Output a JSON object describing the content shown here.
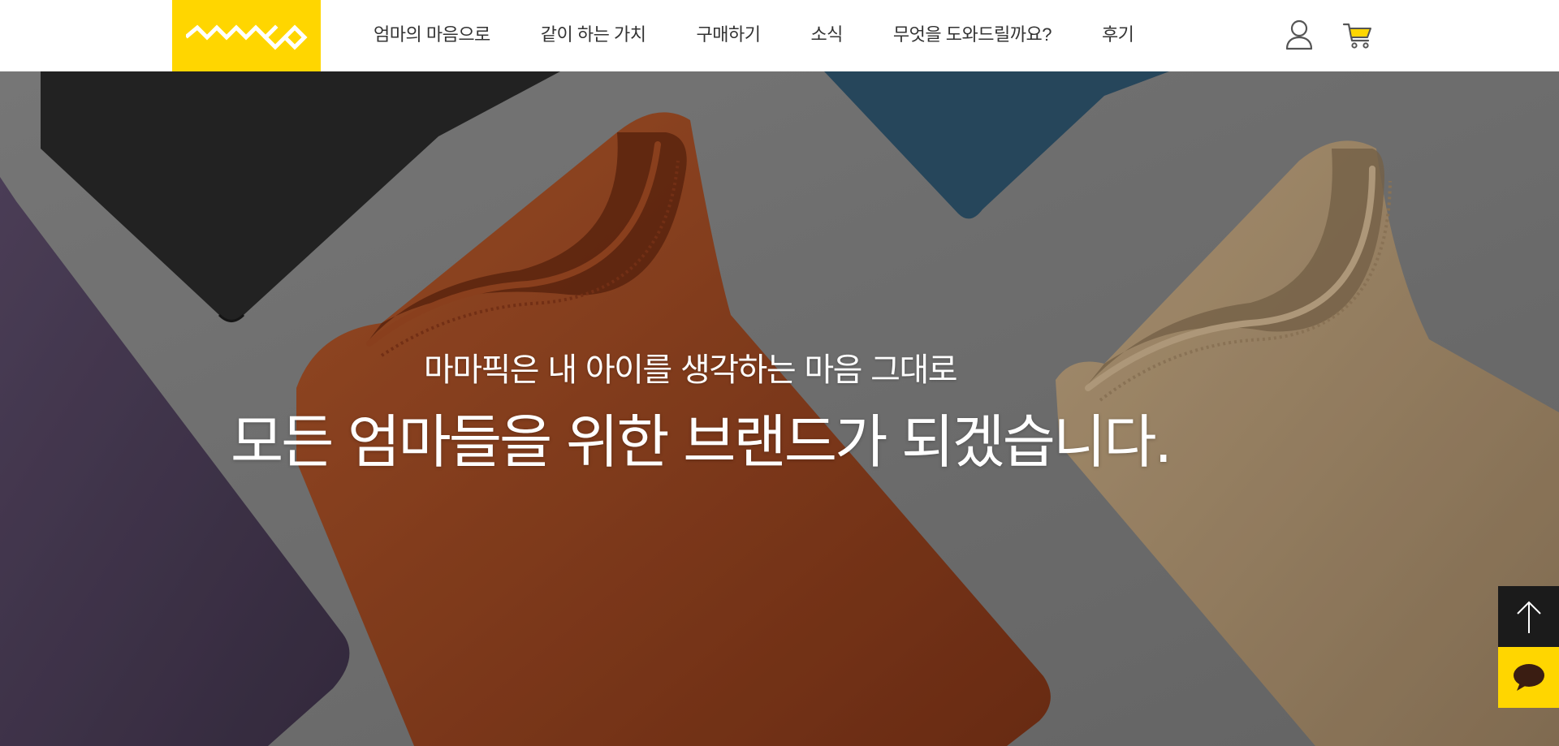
{
  "brand": {
    "logo_icon": "zigzag-logo-icon",
    "accent_color": "#ffd600"
  },
  "nav": {
    "items": [
      {
        "label": "엄마의 마음으로"
      },
      {
        "label": "같이 하는 가치"
      },
      {
        "label": "구매하기"
      },
      {
        "label": "소식"
      },
      {
        "label": "무엇을 도와드릴까요?"
      },
      {
        "label": "후기"
      }
    ]
  },
  "header_icons": {
    "account": "user-icon",
    "cart": "cart-icon"
  },
  "hero": {
    "subtitle": "마마픽은 내 아이를 생각하는 마음 그대로",
    "title": "모든 엄마들을 위한 브랜드가 되겠습니다."
  },
  "floating": {
    "top_button": "arrow-up-icon",
    "chat_button": "chat-bubble-icon",
    "top_bg": "#1b1b1b",
    "chat_bg": "#ffd600"
  }
}
